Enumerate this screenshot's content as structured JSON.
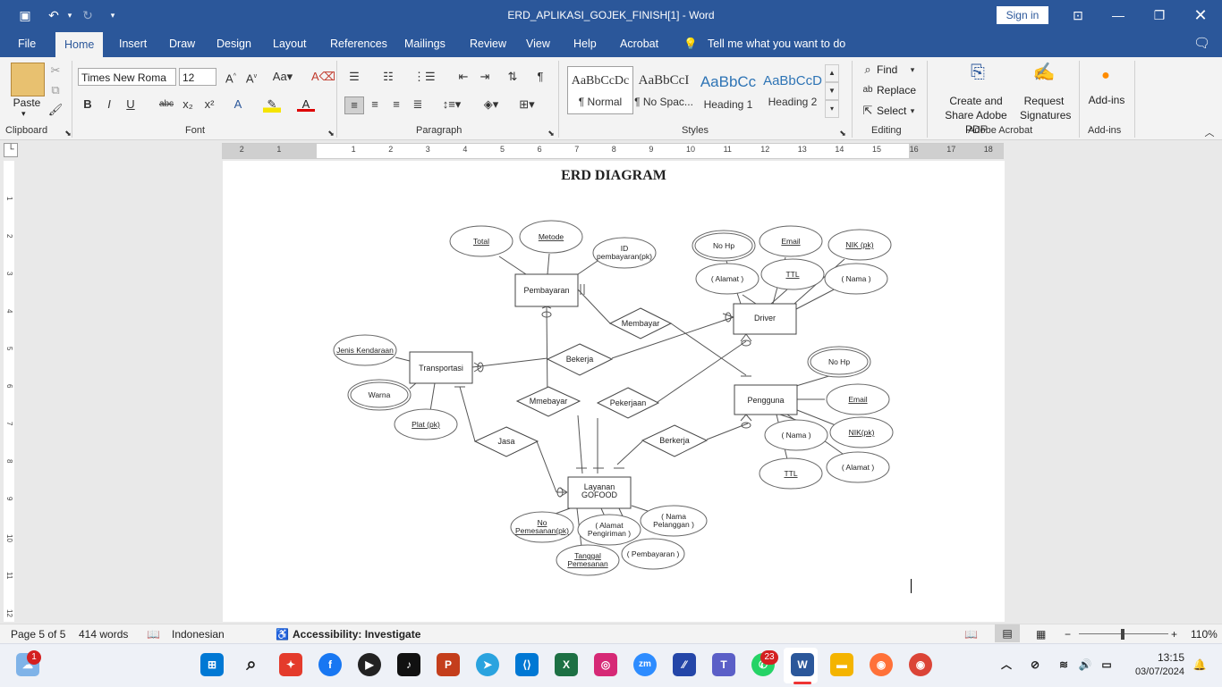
{
  "titlebar": {
    "document_title": "ERD_APLIKASI_GOJEK_FINISH[1]  -  Word",
    "sign_in": "Sign in"
  },
  "menu": {
    "tabs": [
      "File",
      "Home",
      "Insert",
      "Draw",
      "Design",
      "Layout",
      "References",
      "Mailings",
      "Review",
      "View",
      "Help",
      "Acrobat"
    ],
    "tell_me": "Tell me what you want to do"
  },
  "ribbon": {
    "clipboard": {
      "paste": "Paste",
      "label": "Clipboard"
    },
    "font": {
      "name": "Times New Roma",
      "size": "12",
      "label": "Font"
    },
    "paragraph": {
      "label": "Paragraph"
    },
    "styles": {
      "label": "Styles",
      "items": [
        {
          "preview": "AaBbCcDc",
          "name": "¶ Normal"
        },
        {
          "preview": "AaBbCcI",
          "name": "¶ No Spac..."
        },
        {
          "preview": "AaBbCc",
          "name": "Heading 1"
        },
        {
          "preview": "AaBbCcD",
          "name": "Heading 2"
        }
      ]
    },
    "editing": {
      "find": "Find",
      "replace": "Replace",
      "select": "Select",
      "label": "Editing"
    },
    "acrobat": {
      "create": "Create and Share Adobe PDF",
      "request": "Request Signatures",
      "label": "Adobe Acrobat"
    },
    "addins": {
      "button": "Add-ins",
      "label": "Add-ins"
    }
  },
  "ruler": {
    "marks": [
      "2",
      "1",
      "1",
      "2",
      "3",
      "4",
      "5",
      "6",
      "7",
      "8",
      "9",
      "10",
      "11",
      "12",
      "13",
      "14",
      "15",
      "16",
      "17",
      "18"
    ],
    "vmarks": [
      "1",
      "2",
      "3",
      "4",
      "5",
      "6",
      "7",
      "8",
      "9",
      "10",
      "11",
      "12"
    ]
  },
  "document": {
    "heading": "ERD DIAGRAM",
    "entities": [
      "Pembayaran",
      "Driver",
      "Transportasi",
      "Pengguna",
      "Layanan GOFOOD"
    ],
    "relationships": [
      "Membayar",
      "Bekerja",
      "Mmebayar",
      "Pekerjaan",
      "Jasa",
      "Berkerja"
    ],
    "attributes": {
      "pembayaran": [
        "Total",
        "Metode",
        "ID pembayaran(pk)"
      ],
      "driver": [
        "No Hp",
        "Email",
        "NIK (pk)",
        "( Alamat )",
        "TTL",
        "( Nama )"
      ],
      "transportasi": [
        "Jenis Kendaraan",
        "Warna",
        "Plat (pk)"
      ],
      "pengguna": [
        "No Hp",
        "Email",
        "( Nama )",
        "NIK(pk)",
        "TTL",
        "( Alamat )"
      ],
      "layanan": [
        "No Pemesanan(pk)",
        "( Alamat Pengiriman )",
        "( Nama Pelanggan )",
        "Tanggal Pemesanan",
        "( Pembayaran )"
      ]
    }
  },
  "status": {
    "page": "Page 5 of 5",
    "words": "414 words",
    "language": "Indonesian",
    "accessibility": "Accessibility: Investigate",
    "zoom": "110%"
  },
  "taskbar": {
    "time": "13:15",
    "date": "03/07/2024",
    "weather_badge": "1",
    "whatsapp_badge": "23"
  }
}
